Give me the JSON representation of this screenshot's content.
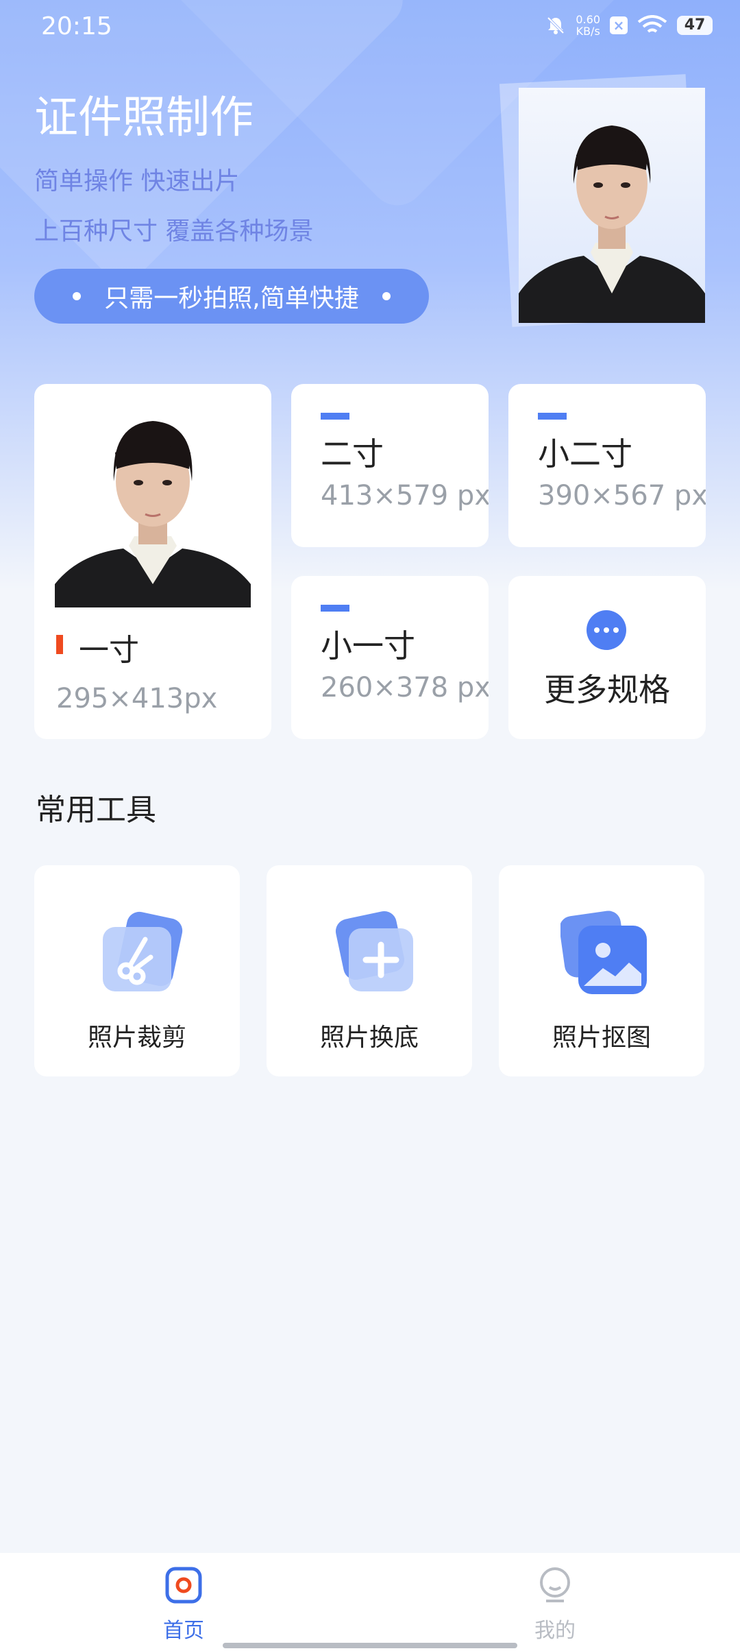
{
  "status_bar": {
    "time": "20:15",
    "net_speed_value": "0.60",
    "net_speed_unit": "KB/s",
    "battery": "47",
    "icons": [
      "bell-muted-icon",
      "close-box-icon",
      "wifi-icon",
      "battery-icon"
    ]
  },
  "hero": {
    "title": "证件照制作",
    "subtitle_1": "简单操作 快速出片",
    "subtitle_2": "上百种尺寸 覆盖各种场景",
    "pill_text": "只需一秒拍照,简单快捷"
  },
  "sizes": [
    {
      "name": "一寸",
      "px": "295×413px"
    },
    {
      "name": "二寸",
      "px": "413×579 px"
    },
    {
      "name": "小二寸",
      "px": "390×567 px"
    },
    {
      "name": "小一寸",
      "px": "260×378 px"
    }
  ],
  "more_sizes_label": "更多规格",
  "tools": {
    "section_title": "常用工具",
    "items": [
      {
        "label": "照片裁剪",
        "icon": "scissors-icon"
      },
      {
        "label": "照片换底",
        "icon": "plus-icon"
      },
      {
        "label": "照片抠图",
        "icon": "image-icon"
      }
    ]
  },
  "bottom_nav": {
    "items": [
      {
        "label": "首页",
        "icon": "camera-icon",
        "active": true
      },
      {
        "label": "我的",
        "icon": "profile-icon",
        "active": false
      }
    ]
  },
  "colors": {
    "accent": "#4f7ef3",
    "mark_red": "#ef4a1f",
    "nav_active": "#3d6fe8",
    "nav_inactive": "#b8bcc3"
  }
}
